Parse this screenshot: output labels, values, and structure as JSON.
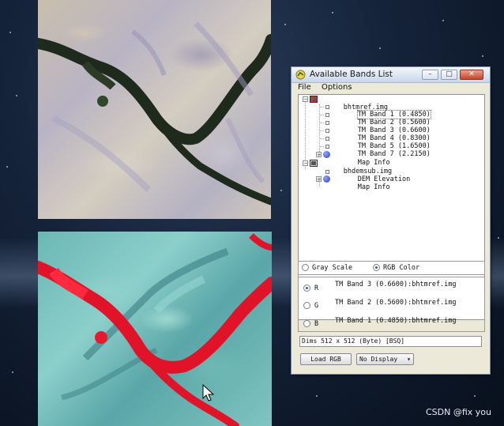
{
  "window": {
    "title": "Available Bands List",
    "menu": [
      "File",
      "Options"
    ],
    "tree": [
      {
        "label": "bhtmref.img",
        "level": 0
      },
      {
        "label": "TM Band 1 (0.4850)",
        "level": 1,
        "selected": true
      },
      {
        "label": "TM Band 2 (0.5600)",
        "level": 1
      },
      {
        "label": "TM Band 3 (0.6600)",
        "level": 1
      },
      {
        "label": "TM Band 4 (0.8300)",
        "level": 1
      },
      {
        "label": "TM Band 5 (1.6500)",
        "level": 1
      },
      {
        "label": "TM Band 7 (2.2150)",
        "level": 1
      },
      {
        "label": "Map Info",
        "level": 1
      },
      {
        "label": "bhdemsub.img",
        "level": 0
      },
      {
        "label": "DEM Elevation",
        "level": 1
      },
      {
        "label": "Map Info",
        "level": 1
      }
    ],
    "mode": {
      "gray_label": "Gray Scale",
      "rgb_label": "RGB Color",
      "selected": "RGB Color"
    },
    "channels": [
      {
        "channel": "R",
        "band": "TM Band 3 (0.6600):bhtmref.img",
        "selected": true
      },
      {
        "channel": "G",
        "band": "TM Band 2 (0.5600):bhtmref.img",
        "selected": false
      },
      {
        "channel": "B",
        "band": "TM Band 1 (0.4850):bhtmref.img",
        "selected": false
      }
    ],
    "dims": "Dims 512 x 512 (Byte) [BSQ]",
    "load_button": "Load RGB",
    "display_select": "No Display"
  },
  "watermark": "CSDN @fix you",
  "icons": {
    "title": "bands-list-icon",
    "file": "image-file-icon",
    "mapinfo": "globe-icon",
    "cursor": "mouse-pointer-icon"
  }
}
